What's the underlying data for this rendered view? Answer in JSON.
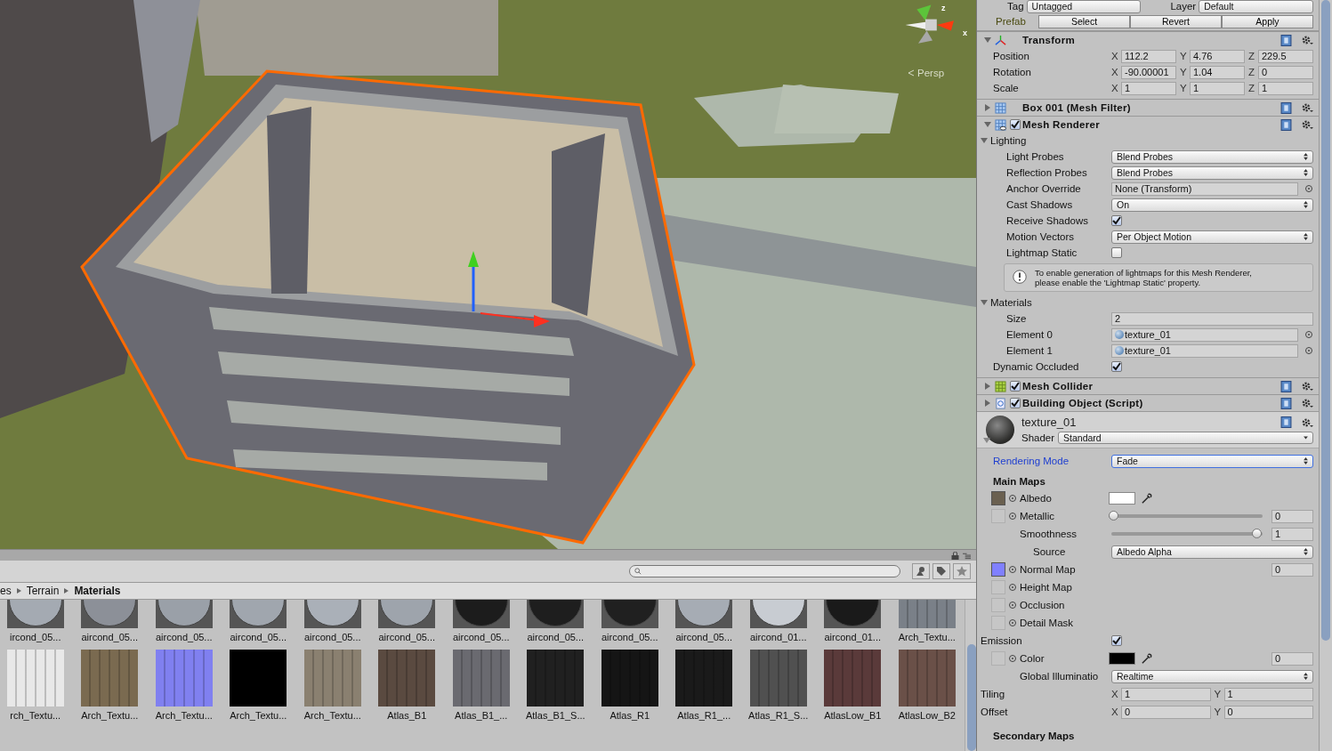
{
  "scene": {
    "projection_label": "Persp",
    "gizmo_labels": [
      "z",
      "x"
    ]
  },
  "project": {
    "breadcrumb": [
      "es",
      "Terrain",
      "Materials"
    ],
    "assets": [
      {
        "name": "ircond_05...",
        "kind": "sphere",
        "color": "#a4aab2"
      },
      {
        "name": "aircond_05...",
        "kind": "sphere",
        "color": "#8c9098"
      },
      {
        "name": "aircond_05...",
        "kind": "sphere",
        "color": "#9aa0a8"
      },
      {
        "name": "aircond_05...",
        "kind": "sphere",
        "color": "#a0a6ae"
      },
      {
        "name": "aircond_05...",
        "kind": "sphere",
        "color": "#aab0b8"
      },
      {
        "name": "aircond_05...",
        "kind": "sphere",
        "color": "#9ea4ac"
      },
      {
        "name": "aircond_05...",
        "kind": "sphere",
        "color": "#1c1c1c"
      },
      {
        "name": "aircond_05...",
        "kind": "sphere",
        "color": "#1e1e1e"
      },
      {
        "name": "aircond_05...",
        "kind": "sphere",
        "color": "#202020"
      },
      {
        "name": "aircond_05...",
        "kind": "sphere",
        "color": "#a6acb4"
      },
      {
        "name": "aircond_01...",
        "kind": "sphere",
        "color": "#c8ccd2"
      },
      {
        "name": "aircond_01...",
        "kind": "sphere",
        "color": "#1a1a1a"
      },
      {
        "name": "Arch_Textu...",
        "kind": "texture",
        "color": "#7a8088"
      },
      {
        "name": "rch_Textu...",
        "kind": "texture",
        "color": "#e8e8e8"
      },
      {
        "name": "Arch_Textu...",
        "kind": "texture",
        "color": "#7a6a50"
      },
      {
        "name": "Arch_Textu...",
        "kind": "texture",
        "color": "#8080f0"
      },
      {
        "name": "Arch_Textu...",
        "kind": "texture",
        "color": "#000000"
      },
      {
        "name": "Arch_Textu...",
        "kind": "texture",
        "color": "#8a8070"
      },
      {
        "name": "Atlas_B1",
        "kind": "texture",
        "color": "#5a4a40"
      },
      {
        "name": "Atlas_B1_...",
        "kind": "texture",
        "color": "#6a6a70"
      },
      {
        "name": "Atlas_B1_S...",
        "kind": "texture",
        "color": "#202020"
      },
      {
        "name": "Atlas_R1",
        "kind": "texture",
        "color": "#151515"
      },
      {
        "name": "Atlas_R1_...",
        "kind": "texture",
        "color": "#1a1a1a"
      },
      {
        "name": "Atlas_R1_S...",
        "kind": "texture",
        "color": "#505050"
      },
      {
        "name": "AtlasLow_B1",
        "kind": "texture",
        "color": "#5a3a3a"
      },
      {
        "name": "AtlasLow_B2",
        "kind": "texture",
        "color": "#6a5048"
      }
    ]
  },
  "inspector": {
    "tag_label": "Tag",
    "tag": "Untagged",
    "layer_label": "Layer",
    "layer": "Default",
    "prefab_label": "Prefab",
    "prefab_buttons": [
      "Select",
      "Revert",
      "Apply"
    ],
    "components": [
      {
        "kind": "transform",
        "title": "Transform",
        "expanded": true,
        "rows": [
          {
            "label": "Position",
            "values": [
              {
                "axis": "X",
                "value": "112.2"
              },
              {
                "axis": "Y",
                "value": "4.76"
              },
              {
                "axis": "Z",
                "value": "229.5"
              }
            ]
          },
          {
            "label": "Rotation",
            "values": [
              {
                "axis": "X",
                "value": "-90.00001"
              },
              {
                "axis": "Y",
                "value": "1.04"
              },
              {
                "axis": "Z",
                "value": "0"
              }
            ]
          },
          {
            "label": "Scale",
            "values": [
              {
                "axis": "X",
                "value": "1"
              },
              {
                "axis": "Y",
                "value": "1"
              },
              {
                "axis": "Z",
                "value": "1"
              }
            ]
          }
        ]
      },
      {
        "kind": "mesh-filter",
        "title": "Box 001 (Mesh Filter)",
        "expanded": false
      },
      {
        "kind": "mesh-renderer",
        "title": "Mesh Renderer",
        "expanded": true,
        "enabled": true,
        "rows": [
          {
            "kind": "foldout",
            "label": "Lighting",
            "expanded": true,
            "children": [
              {
                "kind": "dropdown",
                "label": "Light Probes",
                "value": "Blend Probes"
              },
              {
                "kind": "dropdown",
                "label": "Reflection Probes",
                "value": "Blend Probes"
              },
              {
                "kind": "object",
                "label": "Anchor Override",
                "value": "None (Transform)"
              },
              {
                "kind": "dropdown",
                "label": "Cast Shadows",
                "value": "On"
              },
              {
                "kind": "checkbox",
                "label": "Receive Shadows",
                "checked": true
              },
              {
                "kind": "dropdown",
                "label": "Motion Vectors",
                "value": "Per Object Motion"
              },
              {
                "kind": "checkbox",
                "label": "Lightmap Static",
                "checked": false
              },
              {
                "kind": "info",
                "lines": [
                  "To enable generation of lightmaps for this Mesh Renderer,",
                  "please enable the 'Lightmap Static' property."
                ]
              }
            ]
          },
          {
            "kind": "foldout",
            "label": "Materials",
            "expanded": true,
            "children": [
              {
                "kind": "text",
                "label": "Size",
                "value": "2"
              },
              {
                "kind": "material",
                "label": "Element 0",
                "value": "texture_01"
              },
              {
                "kind": "material",
                "label": "Element 1",
                "value": "texture_01"
              }
            ]
          },
          {
            "kind": "checkbox",
            "label": "Dynamic Occluded",
            "checked": true
          }
        ]
      },
      {
        "kind": "mesh-collider",
        "title": "Mesh Collider",
        "expanded": false,
        "enabled": true
      },
      {
        "kind": "script",
        "title": "Building Object (Script)",
        "expanded": false,
        "enabled": true
      }
    ],
    "material": {
      "name": "texture_01",
      "expanded": true,
      "shader_label": "Shader",
      "shader": "Standard",
      "rendering_mode_label": "Rendering Mode",
      "rendering_mode": "Fade",
      "sections": [
        {
          "title": "Main Maps",
          "rows": [
            {
              "kind": "map",
              "slot": {
                "color": "#6a6050"
              },
              "label": "Albedo",
              "color": "#ffffff"
            },
            {
              "kind": "map",
              "label": "Metallic",
              "level": 0,
              "value": "0"
            },
            {
              "kind": "slider",
              "label": "Smoothness",
              "level": 1,
              "value": "1"
            },
            {
              "kind": "dropdown",
              "label": "Source",
              "value": "Albedo Alpha"
            },
            {
              "kind": "map",
              "slot": {
                "color": "#8080ff"
              },
              "label": "Normal Map",
              "value": "0"
            },
            {
              "kind": "map",
              "label": "Height Map"
            },
            {
              "kind": "map",
              "label": "Occlusion"
            },
            {
              "kind": "map",
              "label": "Detail Mask"
            },
            {
              "kind": "checkbox",
              "label": "Emission",
              "checked": true
            },
            {
              "kind": "map",
              "label": "Color",
              "color": "#000000",
              "value": "0"
            },
            {
              "kind": "dropdown",
              "label": "Global Illuminatio",
              "value": "Realtime"
            },
            {
              "kind": "xy",
              "label": "Tiling",
              "values": [
                {
                  "axis": "X",
                  "value": "1"
                },
                {
                  "axis": "Y",
                  "value": "1"
                }
              ]
            },
            {
              "kind": "xy",
              "label": "Offset",
              "values": [
                {
                  "axis": "X",
                  "value": "0"
                },
                {
                  "axis": "Y",
                  "value": "0"
                }
              ]
            }
          ]
        },
        {
          "title": "Secondary Maps"
        }
      ]
    }
  }
}
